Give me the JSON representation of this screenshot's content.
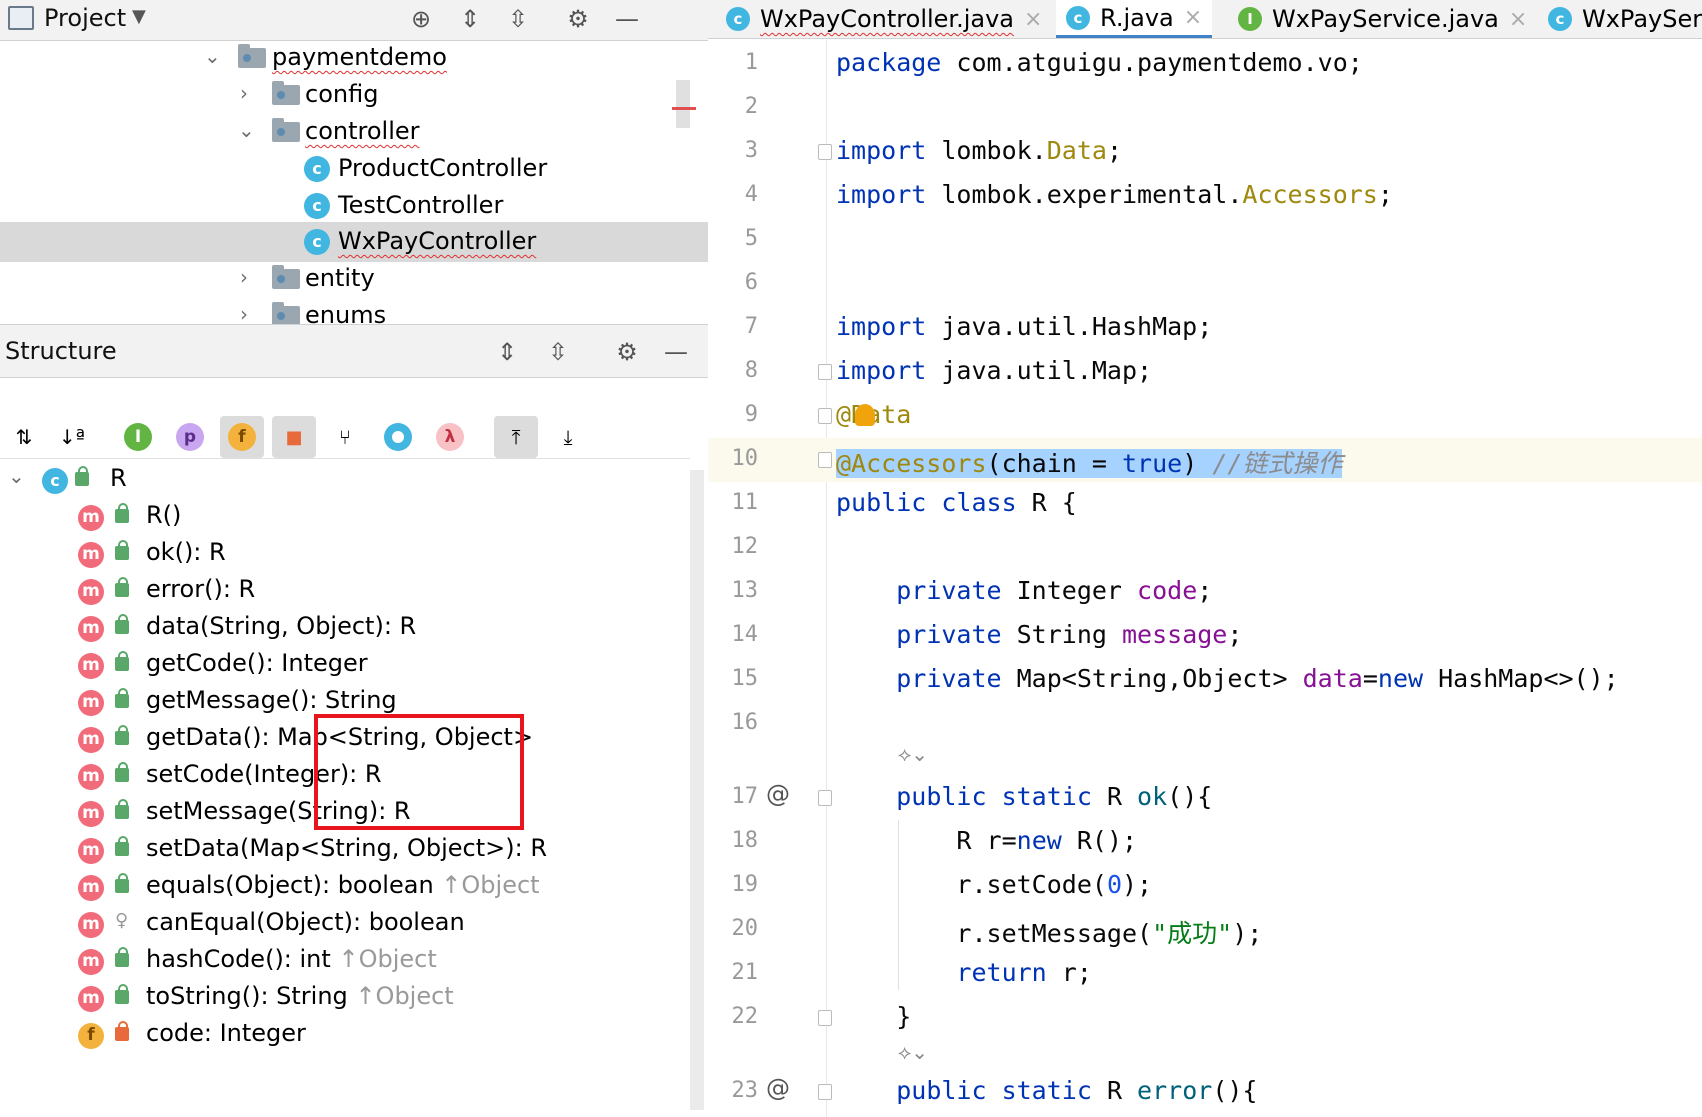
{
  "project_panel": {
    "title": "Project",
    "tree": [
      {
        "label": "paymentdemo",
        "type": "folder",
        "expanded": true,
        "depth": 0
      },
      {
        "label": "config",
        "type": "folder",
        "expanded": false,
        "depth": 1
      },
      {
        "label": "controller",
        "type": "folder",
        "expanded": true,
        "depth": 1
      },
      {
        "label": "ProductController",
        "type": "class",
        "depth": 2
      },
      {
        "label": "TestController",
        "type": "class",
        "depth": 2
      },
      {
        "label": "WxPayController",
        "type": "class",
        "depth": 2,
        "selected": true
      },
      {
        "label": "entity",
        "type": "folder",
        "expanded": false,
        "depth": 1
      },
      {
        "label": "enums",
        "type": "folder",
        "expanded": false,
        "depth": 1
      }
    ]
  },
  "structure_panel": {
    "title": "Structure",
    "root": "R",
    "members": [
      {
        "label": "R()",
        "kind": "method"
      },
      {
        "label": "ok(): R",
        "kind": "method-static"
      },
      {
        "label": "error(): R",
        "kind": "method-static"
      },
      {
        "label": "data(String, Object): R",
        "kind": "method"
      },
      {
        "label": "getCode(): Integer",
        "kind": "method"
      },
      {
        "label": "getMessage(): String",
        "kind": "method"
      },
      {
        "label": "getData(): Map<String, Object>",
        "kind": "method"
      },
      {
        "label": "setCode(Integer): R",
        "kind": "method"
      },
      {
        "label": "setMessage(String): R",
        "kind": "method"
      },
      {
        "label": "setData(Map<String, Object>): R",
        "kind": "method"
      },
      {
        "label": "equals(Object): boolean",
        "suffix": "↑Object",
        "kind": "method"
      },
      {
        "label": "canEqual(Object): boolean",
        "kind": "method-protected"
      },
      {
        "label": "hashCode(): int",
        "suffix": "↑Object",
        "kind": "method"
      },
      {
        "label": "toString(): String",
        "suffix": "↑Object",
        "kind": "method"
      },
      {
        "label": "code: Integer",
        "kind": "field-private"
      }
    ]
  },
  "editor": {
    "tabs": [
      {
        "label": "WxPayController.java",
        "icon": "class-icon",
        "active": false
      },
      {
        "label": "R.java",
        "icon": "class-icon",
        "active": true
      },
      {
        "label": "WxPayService.java",
        "icon": "interface-icon",
        "active": false
      },
      {
        "label": "WxPaySer",
        "icon": "class-icon",
        "active": false
      }
    ],
    "line_numbers": [
      "1",
      "2",
      "3",
      "4",
      "5",
      "6",
      "7",
      "8",
      "9",
      "10",
      "11",
      "12",
      "13",
      "14",
      "15",
      "16",
      "17",
      "18",
      "19",
      "20",
      "21",
      "22",
      "23"
    ],
    "lines": {
      "l1": "package com.atguigu.paymentdemo.vo;",
      "l3a": "import",
      "l3b": " lombok.",
      "l3c": "Data",
      "l3d": ";",
      "l4a": "import",
      "l4b": " lombok.experimental.",
      "l4c": "Accessors",
      "l4d": ";",
      "l7a": "import",
      "l7b": " java.util.HashMap;",
      "l8a": "import",
      "l8b": " java.util.Map;",
      "l9": "@Data",
      "l10a": "@Accessors",
      "l10b": "(chain = ",
      "l10c": "true",
      "l10d": ") ",
      "l10e": "//链式操作",
      "l11a": "public class",
      "l11b": " R {",
      "l13a": "private",
      "l13b": " Integer ",
      "l13c": "code",
      "l13d": ";",
      "l14a": "private",
      "l14b": " String ",
      "l14c": "message",
      "l14d": ";",
      "l15a": "private",
      "l15b": " Map<String,Object> ",
      "l15c": "data",
      "l15d": "=",
      "l15e": "new",
      "l15f": " HashMap<>();",
      "l17a": "public static",
      "l17b": " R ",
      "l17c": "ok",
      "l17d": "(){",
      "l18a": "R r=",
      "l18b": "new",
      "l18c": " R();",
      "l19a": "r.setCode(",
      "l19b": "0",
      "l19c": ");",
      "l20a": "r.setMessage(",
      "l20b": "\"成功\"",
      "l20c": ");",
      "l21a": "return",
      "l21b": " r;",
      "l22": "}",
      "l23a": "public static",
      "l23b": " R ",
      "l23c": "error",
      "l23d": "(){"
    },
    "gutter_at": "@"
  }
}
